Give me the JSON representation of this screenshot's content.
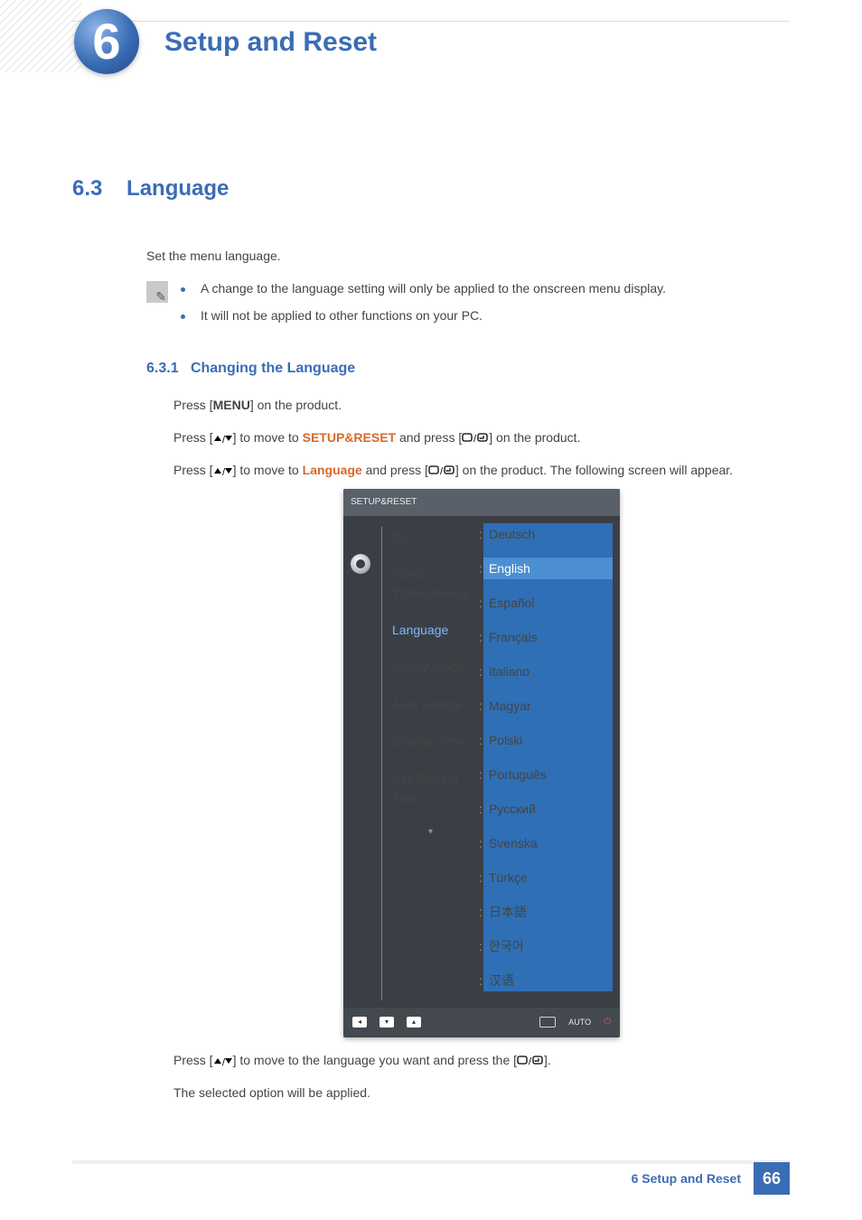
{
  "chapter": {
    "number": "6",
    "title": "Setup and Reset"
  },
  "section": {
    "number": "6.3",
    "title": "Language"
  },
  "intro": "Set the menu language.",
  "notes": [
    "A change to the language setting will only be applied to the onscreen menu display.",
    "It will not be applied to other functions on your PC."
  ],
  "subsection": {
    "number": "6.3.1",
    "title": "Changing the Language"
  },
  "steps": {
    "s1_a": "Press [",
    "s1_menu": "MENU",
    "s1_b": "] on the product.",
    "s2_a": "Press [",
    "s2_b": "] to move to ",
    "s2_target": "SETUP&RESET",
    "s2_c": " and press [",
    "s2_d": "] on the product.",
    "s3_a": "Press [",
    "s3_b": "] to move to ",
    "s3_target": "Language",
    "s3_c": " and press [",
    "s3_d": "] on the product. The following screen will appear.",
    "s4_a": "Press [",
    "s4_b": "] to move to the language you want and press the [",
    "s4_c": "].",
    "s5": "The selected option will be applied."
  },
  "osd": {
    "title": "SETUP&RESET",
    "menu": [
      "ECO",
      "Menu Transparency",
      "Language",
      "PC/AV Mode",
      "Auto Source",
      "Display Time",
      "Key Repeat Time"
    ],
    "active_index": 2,
    "languages": [
      "Deutsch",
      "English",
      "Español",
      "Français",
      "Italiano",
      "Magyar",
      "Polski",
      "Português",
      "Русский",
      "Svenska",
      "Türkçe",
      "日本語",
      "한국어",
      "汉语"
    ],
    "selected_language_index": 1,
    "auto_label": "AUTO"
  },
  "footer": {
    "label": "6 Setup and Reset",
    "page": "66"
  }
}
